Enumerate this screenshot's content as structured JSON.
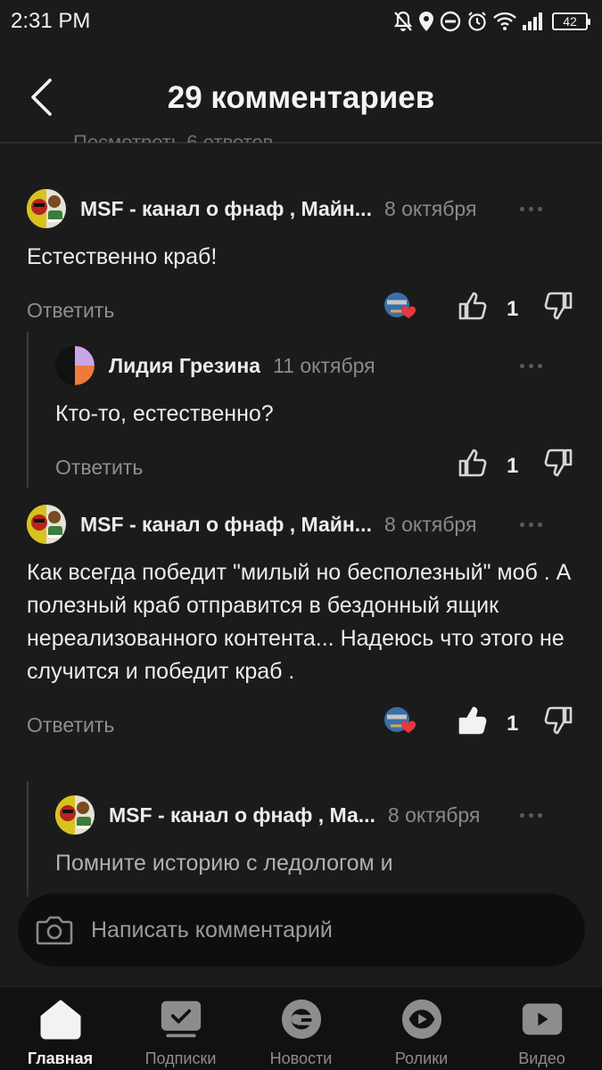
{
  "status_bar": {
    "time": "2:31 PM",
    "battery": "42",
    "icons": [
      "notifications-off-icon",
      "location-icon",
      "do-not-disturb-icon",
      "alarm-icon",
      "wifi-icon",
      "signal-icon",
      "battery-icon"
    ]
  },
  "header": {
    "title": "29 комментариев",
    "back_icon": "chevron-left-icon"
  },
  "cut_off_text": "Посмотреть 6 ответов",
  "comments": [
    {
      "author": "MSF - канал о фнаф , Майн...",
      "date": "8 октября",
      "text": "Естественно краб!",
      "reply_label": "Ответить",
      "likes": "1",
      "has_reactor": true,
      "liked": false
    },
    {
      "author": "Лидия Грезина",
      "date": "11 октября",
      "text": "Кто-то, естественно?",
      "reply_label": "Ответить",
      "likes": "1",
      "has_reactor": false,
      "liked": false
    },
    {
      "author": "MSF - канал о фнаф , Майн...",
      "date": "8 октября",
      "text": "Как всегда победит \"милый но бесполезный\" моб . А полезный краб отправится в бездонный ящик нереализованного контента... Надеюсь что этого не случится и победит краб .",
      "reply_label": "Ответить",
      "likes": "1",
      "has_reactor": true,
      "liked": true
    },
    {
      "author": "MSF - канал о фнаф , Ма...",
      "date": "8 октября",
      "text": "Помните историю с ледологом и",
      "reply_label": "",
      "likes": "",
      "has_reactor": false,
      "liked": false
    }
  ],
  "composer": {
    "placeholder": "Написать комментарий",
    "icon": "camera-icon"
  },
  "bottom_nav": {
    "items": [
      {
        "label": "Главная",
        "icon": "home-icon",
        "active": true
      },
      {
        "label": "Подписки",
        "icon": "subscriptions-icon",
        "active": false
      },
      {
        "label": "Новости",
        "icon": "news-icon",
        "active": false
      },
      {
        "label": "Ролики",
        "icon": "shorts-icon",
        "active": false
      },
      {
        "label": "Видео",
        "icon": "video-icon",
        "active": false
      }
    ]
  },
  "colors": {
    "background": "#1b1b1b",
    "text": "#ececec",
    "muted": "#8e8e8e",
    "heart": "#e8383d"
  }
}
